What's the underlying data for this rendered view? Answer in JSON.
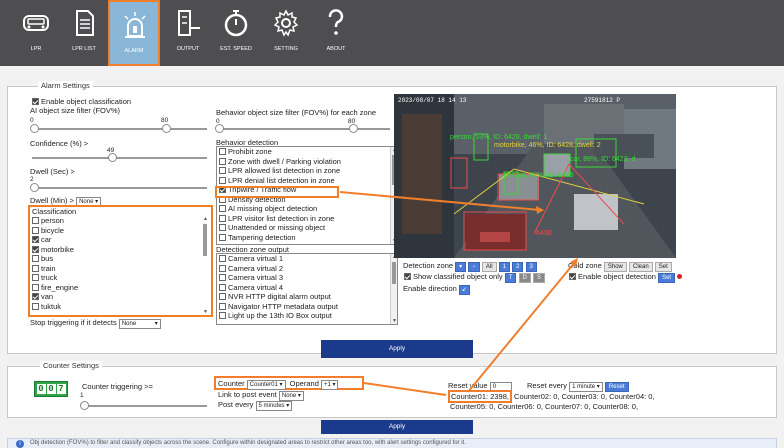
{
  "nav": [
    {
      "label": "LPR",
      "icon": "car-icon"
    },
    {
      "label": "LPR LIST",
      "icon": "document-icon"
    },
    {
      "label": "ALARM",
      "icon": "alarm-icon"
    },
    {
      "label": "OUTPUT",
      "icon": "output-icon"
    },
    {
      "label": "EST. SPEED",
      "icon": "stopwatch-icon"
    },
    {
      "label": "SETTING",
      "icon": "gear-icon"
    },
    {
      "label": "ABOUT",
      "icon": "question-icon"
    }
  ],
  "alarm": {
    "legend": "Alarm Settings",
    "enable_classification": "Enable object classification",
    "ai_size_label": "AI object size filter (FOV%)",
    "ai_min": "0",
    "ai_max": "80",
    "confidence_label": "Confidence (%) >",
    "confidence_value": "49",
    "dwell_label": "Dwell (Sec) >",
    "dwell_value": "2",
    "dwell_min_label": "Dwell (Min) >",
    "dwell_min_value": "None",
    "classification_label": "Classification",
    "classes": [
      {
        "label": "person",
        "checked": false
      },
      {
        "label": "bicycle",
        "checked": false
      },
      {
        "label": "car",
        "checked": true
      },
      {
        "label": "motorbike",
        "checked": true
      },
      {
        "label": "bus",
        "checked": false
      },
      {
        "label": "train",
        "checked": false
      },
      {
        "label": "truck",
        "checked": false
      },
      {
        "label": "fire_engine",
        "checked": false
      },
      {
        "label": "van",
        "checked": true
      },
      {
        "label": "tuktuk",
        "checked": false
      }
    ],
    "stop_label": "Stop triggering if it detects",
    "stop_value": "None",
    "behavior_size_label": "Behavior object size filter (FOV%) for each zone",
    "behavior_min": "0",
    "behavior_max": "80",
    "behavior_detection_label": "Behavior detection",
    "behaviors": [
      {
        "label": "Prohibit zone",
        "checked": false
      },
      {
        "label": "Zone with dwell / Parking violation",
        "checked": false
      },
      {
        "label": "LPR allowed list detection in zone",
        "checked": false
      },
      {
        "label": "LPR denial list detection in zone",
        "checked": false
      },
      {
        "label": "Tripwire / Traffic flow",
        "checked": true
      },
      {
        "label": "Density detection",
        "checked": false
      },
      {
        "label": "AI missing object detection",
        "checked": false
      },
      {
        "label": "LPR visitor list detection in zone",
        "checked": false
      },
      {
        "label": "Unattended or missing object",
        "checked": false
      },
      {
        "label": "Tampering detection",
        "checked": false
      }
    ],
    "zone_output_label": "Detection zone output",
    "zone_outputs": [
      {
        "label": "Camera virtual 1",
        "checked": false
      },
      {
        "label": "Camera virtual 2",
        "checked": false
      },
      {
        "label": "Camera virtual 3",
        "checked": false
      },
      {
        "label": "Camera virtual 4",
        "checked": false
      },
      {
        "label": "NVR HTTP digital alarm output",
        "checked": false
      },
      {
        "label": "Navigator HTTP metadata output",
        "checked": false
      },
      {
        "label": "Light up the 13th IO Box output",
        "checked": false
      }
    ],
    "camera": {
      "timestamp": "2023/08/07 18 14 13",
      "timestamp_right": "27591812 P",
      "detections": [
        {
          "text": "person, 53%, ID: 6428, dwell: 1",
          "color": "#3ad63a"
        },
        {
          "text": "motorbike, 46%, ID: 6428, dwell: 2",
          "color": "#e0d23a"
        },
        {
          "text": "car, 88%, ID: 6423, d",
          "color": "#3ad63a"
        },
        {
          "text": "person, 82%, ID: 6439",
          "color": "#3ad63a"
        },
        {
          "text": "6430",
          "color": "#e84c4c"
        }
      ]
    },
    "detection_zone_label": "Detection zone",
    "zone_all": "All",
    "zone_nums": [
      "1",
      "2",
      "3"
    ],
    "show_classified": "Show classified object only",
    "tds": [
      "T",
      "D",
      "S"
    ],
    "enable_direction": "Enable direction",
    "cold_zone_label": "Cold zone",
    "cold_buttons": [
      "Show",
      "Clean",
      "Set"
    ],
    "enable_object_detection": "Enable object detection",
    "set_label": "Set",
    "apply": "Apply"
  },
  "counter": {
    "legend": "Counter Settings",
    "display": [
      "0",
      "0",
      "7"
    ],
    "triggering_label": "Counter triggering >=",
    "triggering_value": "1",
    "counter_label": "Counter",
    "counter_value": "Counter01",
    "operand_label": "Operand",
    "operand_value": "+1",
    "link_label": "Link to post event",
    "link_value": "None",
    "post_every_label": "Post every",
    "post_every_value": "5 minutes",
    "reset_value_label": "Reset value",
    "reset_value": "0",
    "reset_every_label": "Reset every",
    "reset_every_value": "1 minute",
    "reset_button": "Reset",
    "counts_line1_hl": "Counter01: 2398,",
    "counts_line1_rest": " Counter02: 0, Counter03: 0, Counter04: 0,",
    "counts_line2": "Counter05: 0, Counter06: 0, Counter07: 0, Counter08: 0,",
    "apply": "Apply"
  },
  "info_text": "Obj detection (FOV%) to filter and classify objects across the scene. Configure within designated areas to restrict other areas too, with alert settings configured for it."
}
